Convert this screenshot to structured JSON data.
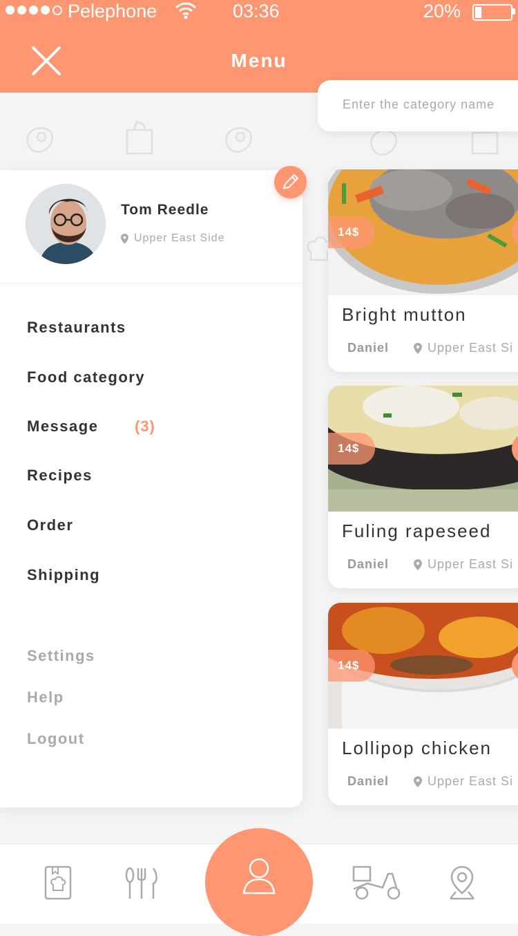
{
  "status_bar": {
    "carrier": "Pelephone",
    "time": "03:36",
    "battery": "20%",
    "battery_level": 0.2
  },
  "header": {
    "title": "Menu"
  },
  "search": {
    "placeholder": "Enter the category name"
  },
  "profile": {
    "name": "Tom Reedle",
    "location": "Upper East Side"
  },
  "menu": {
    "items": [
      {
        "label": "Restaurants"
      },
      {
        "label": "Food category"
      },
      {
        "label": "Message",
        "badge": "(3)"
      },
      {
        "label": "Recipes"
      },
      {
        "label": "Order"
      },
      {
        "label": "Shipping"
      }
    ],
    "secondary": [
      {
        "label": "Settings"
      },
      {
        "label": "Help"
      },
      {
        "label": "Logout"
      }
    ]
  },
  "cards": [
    {
      "price": "14$",
      "dish": "Bright mutton",
      "author": "Daniel",
      "location": "Upper East Si"
    },
    {
      "price": "14$",
      "dish": "Fuling rapeseed",
      "author": "Daniel",
      "location": "Upper East Si"
    },
    {
      "price": "14$",
      "dish": "Lollipop chicken",
      "author": "Daniel",
      "location": "Upper East Si"
    }
  ],
  "colors": {
    "accent": "#fe9672",
    "background": "#f4f4f4"
  },
  "icons": {
    "bottom_nav": [
      "recipe-book-icon",
      "cutlery-icon",
      "user-icon",
      "delivery-scooter-icon",
      "map-pin-icon"
    ]
  }
}
